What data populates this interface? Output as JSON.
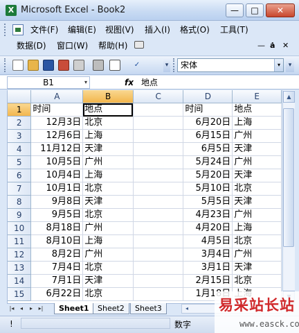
{
  "window": {
    "title": "Microsoft Excel - Book2",
    "min": "—",
    "max": "□",
    "close": "✕"
  },
  "menu": {
    "row1": [
      "文件(F)",
      "编辑(E)",
      "视图(V)",
      "插入(I)",
      "格式(O)",
      "工具(T)"
    ],
    "row2": [
      "数据(D)",
      "窗口(W)",
      "帮助(H)"
    ],
    "doc_min": "—",
    "doc_restore": "ȧ",
    "doc_close": "✕"
  },
  "toolbar": {
    "font": "宋体",
    "font_dd": "▾"
  },
  "formula": {
    "namebox": "B1",
    "fx": "fx",
    "content": "地点"
  },
  "grid": {
    "columns": [
      "A",
      "B",
      "C",
      "D",
      "E"
    ],
    "active_col": "B",
    "active_row": 1,
    "rows": [
      [
        "1",
        "时间",
        "地点",
        "",
        "时间",
        "地点"
      ],
      [
        "2",
        "12月3日",
        "北京",
        "",
        "6月20日",
        "上海"
      ],
      [
        "3",
        "12月6日",
        "上海",
        "",
        "6月15日",
        "广州"
      ],
      [
        "4",
        "11月12日",
        "天津",
        "",
        "6月5日",
        "天津"
      ],
      [
        "5",
        "10月5日",
        "广州",
        "",
        "5月24日",
        "广州"
      ],
      [
        "6",
        "10月4日",
        "上海",
        "",
        "5月20日",
        "天津"
      ],
      [
        "7",
        "10月1日",
        "北京",
        "",
        "5月10日",
        "北京"
      ],
      [
        "8",
        "9月8日",
        "天津",
        "",
        "5月5日",
        "天津"
      ],
      [
        "9",
        "9月5日",
        "北京",
        "",
        "4月23日",
        "广州"
      ],
      [
        "10",
        "8月18日",
        "广州",
        "",
        "4月20日",
        "上海"
      ],
      [
        "11",
        "8月10日",
        "上海",
        "",
        "4月5日",
        "北京"
      ],
      [
        "12",
        "8月2日",
        "广州",
        "",
        "3月4日",
        "广州"
      ],
      [
        "13",
        "7月4日",
        "北京",
        "",
        "3月1日",
        "天津"
      ],
      [
        "14",
        "7月1日",
        "天津",
        "",
        "2月15日",
        "北京"
      ],
      [
        "15",
        "6月22日",
        "北京",
        "",
        "1月18日",
        "上海"
      ]
    ]
  },
  "sheets": {
    "tabs": [
      "Sheet1",
      "Sheet2",
      "Sheet3"
    ],
    "active": 0
  },
  "status": {
    "left": "!",
    "mode": "数字"
  },
  "watermark": {
    "cn": "易采站长站",
    "url": "www.easck.com"
  },
  "colors": {
    "title_gradient_top": "#e7f0fb",
    "header_active": "#f2b54c",
    "close": "#c8462d",
    "watermark": "#d0282a"
  }
}
